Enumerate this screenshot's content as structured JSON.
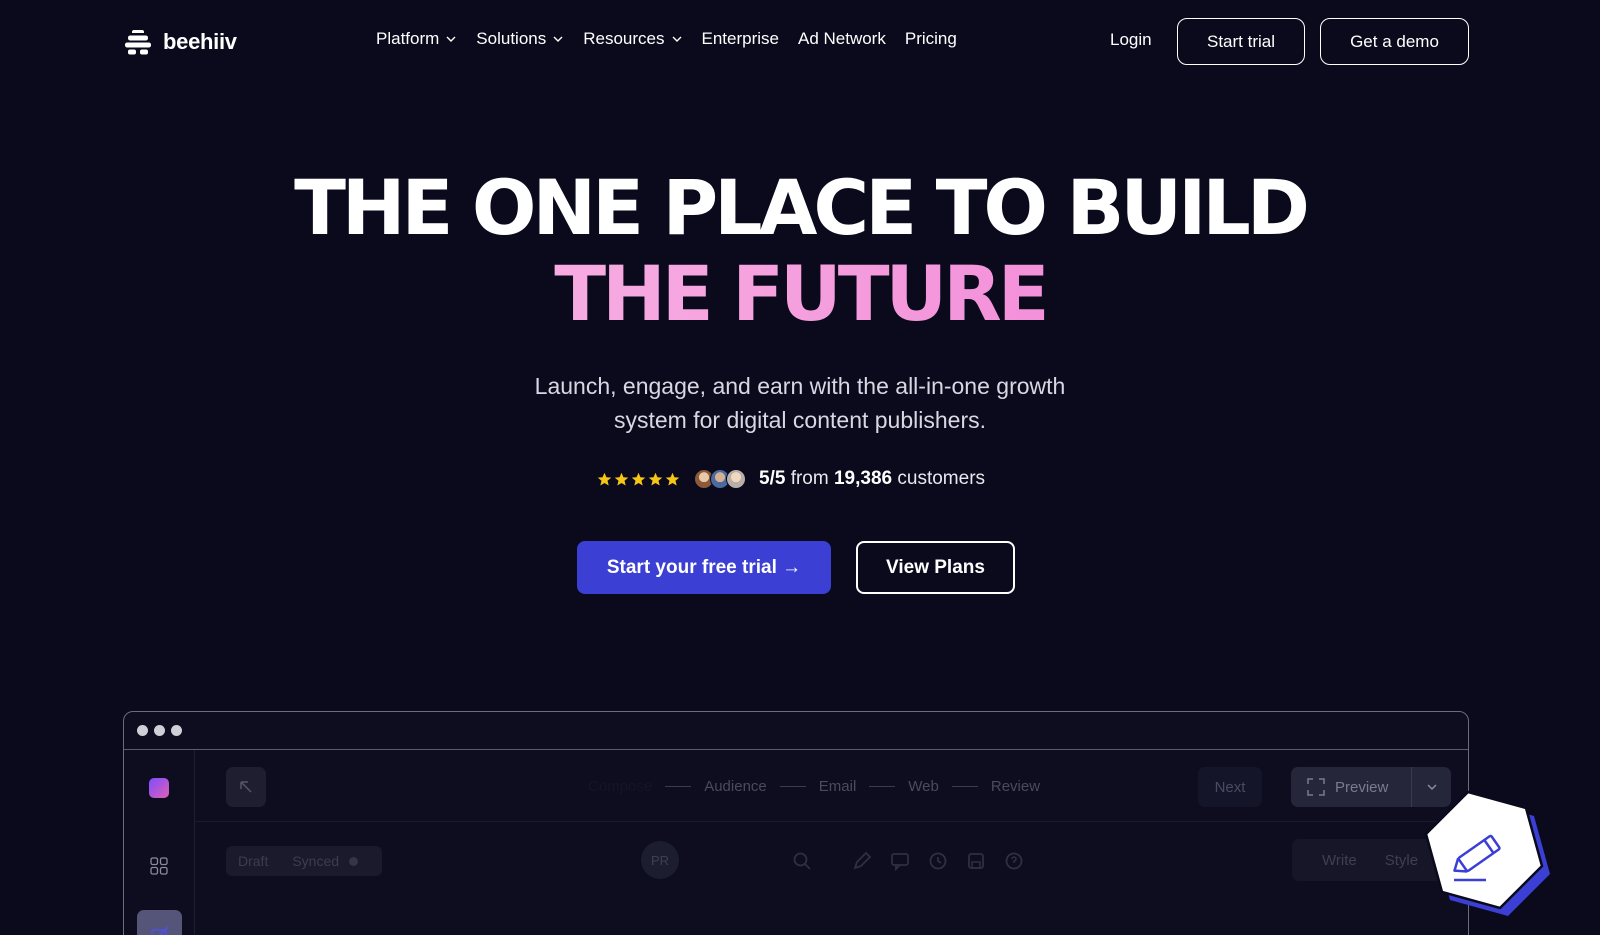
{
  "brand": {
    "name": "beehiiv"
  },
  "nav": {
    "items": [
      {
        "label": "Platform",
        "dropdown": true
      },
      {
        "label": "Solutions",
        "dropdown": true
      },
      {
        "label": "Resources",
        "dropdown": true
      },
      {
        "label": "Enterprise",
        "dropdown": false
      },
      {
        "label": "Ad Network",
        "dropdown": false
      },
      {
        "label": "Pricing",
        "dropdown": false
      }
    ],
    "login": "Login",
    "start_trial": "Start trial",
    "get_demo": "Get a demo"
  },
  "hero": {
    "headline_line1": "THE ONE PLACE TO BUILD",
    "headline_line2": "THE FUTURE",
    "subtitle": "Launch, engage, and earn with the all-in-one growth system for digital content publishers.",
    "rating": {
      "stars": 5,
      "score": "5/5",
      "from": "from",
      "count": "19,386",
      "suffix": "customers"
    },
    "cta_primary": "Start your free trial →",
    "cta_secondary": "View Plans"
  },
  "app_preview": {
    "steps": [
      "Compose",
      "Audience",
      "Email",
      "Web",
      "Review"
    ],
    "next": "Next",
    "preview": "Preview",
    "status_draft": "Draft",
    "status_synced": "Synced",
    "avatar_initials": "PR",
    "mode_write": "Write",
    "mode_style": "Style"
  },
  "colors": {
    "background": "#0a0a1c",
    "primary_button": "#3b3fd4",
    "gradient_start": "#f9c2ea",
    "gradient_end": "#ee6fd1",
    "star": "#f5c518"
  }
}
